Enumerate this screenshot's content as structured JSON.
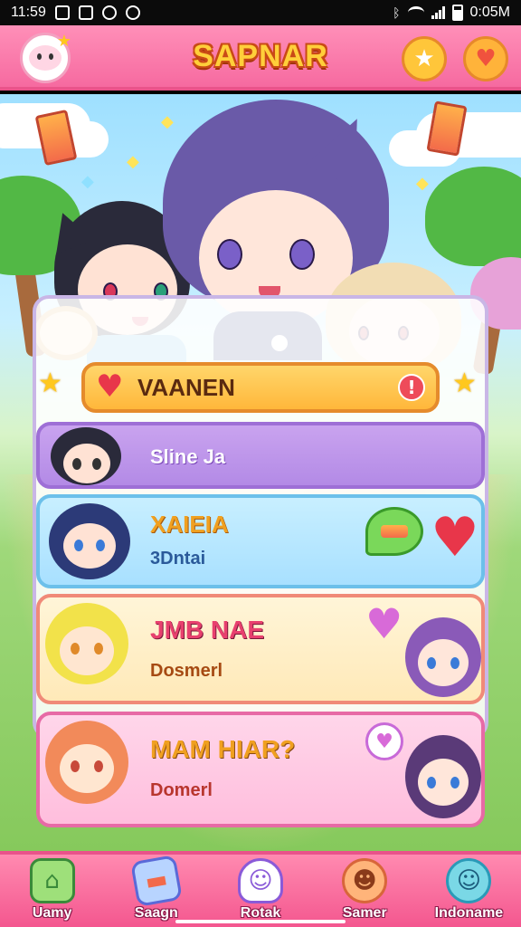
{
  "status_bar": {
    "time": "11:59",
    "right_time": "0:05M"
  },
  "header": {
    "title": "SAPNAR",
    "logo_icon": "smile-bubble-icon",
    "star_button_icon": "star-icon",
    "heart_button_icon": "heart-icon"
  },
  "banner": {
    "title": "VAANEN",
    "alert": "!"
  },
  "list": [
    {
      "name": "Sline Ja",
      "sub": ""
    },
    {
      "name": "XAIEIA",
      "sub": "3Dntai"
    },
    {
      "name": "JMB NAE",
      "sub": "Dosmerl"
    },
    {
      "name": "MAM HIAR?",
      "sub": "Domerl"
    }
  ],
  "tabs": [
    {
      "label": "Uamy",
      "icon": "house-icon"
    },
    {
      "label": "Saagn",
      "icon": "game-card-icon"
    },
    {
      "label": "Rotak",
      "icon": "ghost-icon"
    },
    {
      "label": "Samer",
      "icon": "fox-face-icon"
    },
    {
      "label": "Indoname",
      "icon": "smile-face-icon"
    }
  ],
  "colors": {
    "header_pink": "#f66aa0",
    "title_gold": "#ffcf3a",
    "banner_gold": "#ffb73b",
    "tab_pink": "#f4578f"
  }
}
